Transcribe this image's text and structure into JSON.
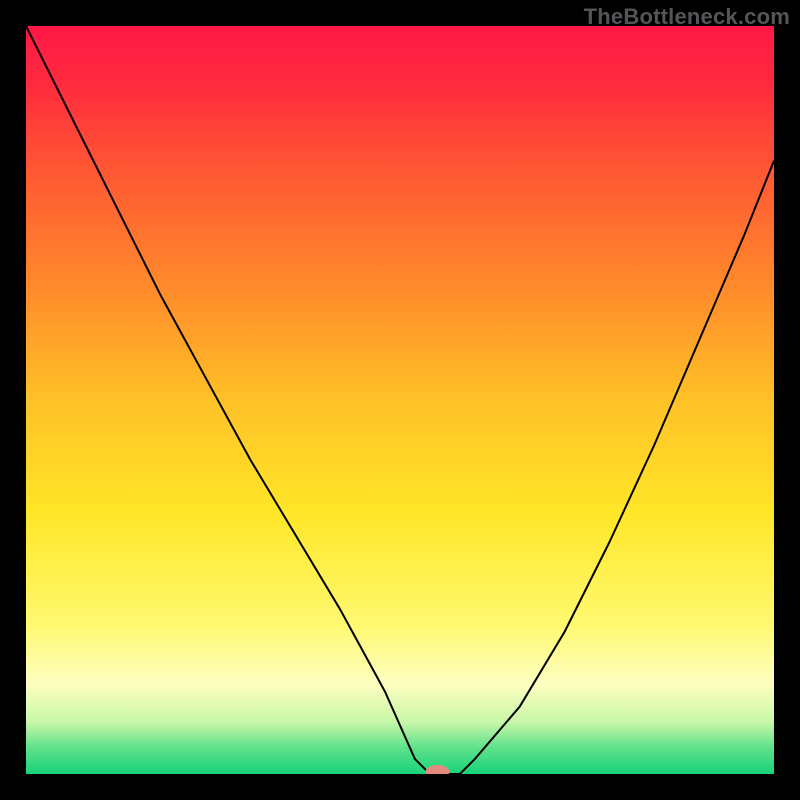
{
  "watermark": "TheBottleneck.com",
  "chart_data": {
    "type": "line",
    "title": "",
    "xlabel": "",
    "ylabel": "",
    "xlim": [
      0,
      100
    ],
    "ylim": [
      0,
      100
    ],
    "grid": false,
    "series": [
      {
        "name": "curve",
        "x": [
          0,
          6,
          12,
          18,
          24,
          30,
          36,
          42,
          48,
          52,
          54,
          56,
          58,
          60,
          66,
          72,
          78,
          84,
          90,
          96,
          100
        ],
        "y": [
          100,
          88,
          76,
          64,
          53,
          42,
          32,
          22,
          11,
          2,
          0,
          0,
          0,
          2,
          9,
          19,
          31,
          44,
          58,
          72,
          82
        ]
      }
    ],
    "gradient_stops": [
      {
        "offset": 0.0,
        "color": "#ff1846"
      },
      {
        "offset": 0.08,
        "color": "#ff2b3e"
      },
      {
        "offset": 0.2,
        "color": "#ff5a33"
      },
      {
        "offset": 0.35,
        "color": "#ff8a2b"
      },
      {
        "offset": 0.5,
        "color": "#ffc127"
      },
      {
        "offset": 0.65,
        "color": "#ffe627"
      },
      {
        "offset": 0.8,
        "color": "#fff970"
      },
      {
        "offset": 0.88,
        "color": "#fdfec0"
      },
      {
        "offset": 0.93,
        "color": "#c9f7a8"
      },
      {
        "offset": 0.965,
        "color": "#5fe18b"
      },
      {
        "offset": 1.0,
        "color": "#17d37a"
      }
    ],
    "marker": {
      "x": 55,
      "y": 0.3,
      "color": "#e58a80",
      "rx": 1.6,
      "ry": 0.9
    }
  }
}
